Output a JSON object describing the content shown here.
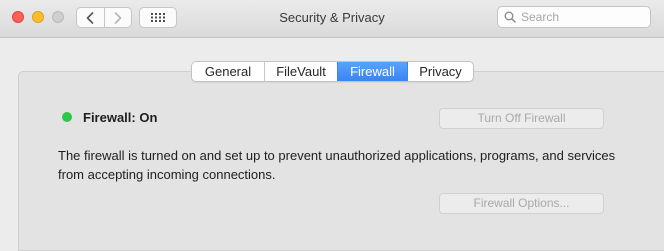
{
  "window": {
    "title": "Security & Privacy",
    "traffic_lights": [
      "close",
      "minimize",
      "zoom-disabled"
    ]
  },
  "toolbar": {
    "back_icon": "chevron-left-icon",
    "forward_icon": "chevron-right-icon",
    "show_all_icon": "grid-icon",
    "search": {
      "placeholder": "Search",
      "value": "",
      "icon": "search-icon"
    }
  },
  "tabs": [
    {
      "label": "General",
      "active": false
    },
    {
      "label": "FileVault",
      "active": false
    },
    {
      "label": "Firewall",
      "active": true
    },
    {
      "label": "Privacy",
      "active": false
    }
  ],
  "firewall": {
    "status_label": "Firewall: On",
    "status_color": "#2dc84b",
    "turn_off_label": "Turn Off Firewall",
    "turn_off_enabled": false,
    "description": "The firewall is turned on and set up to prevent unauthorized applications, programs, and services from accepting incoming connections.",
    "options_label": "Firewall Options...",
    "options_enabled": false
  },
  "colors": {
    "accent": "#3a84f5",
    "close": "#fe5f57",
    "minimize": "#febc2e"
  }
}
